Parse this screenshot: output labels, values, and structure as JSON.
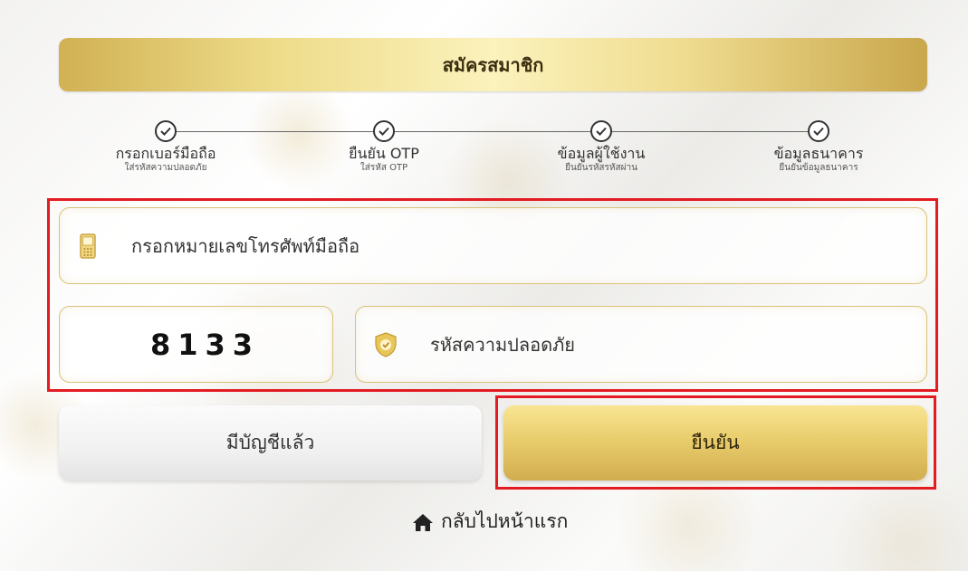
{
  "header": {
    "title": "สมัครสมาชิก"
  },
  "steps": [
    {
      "title": "กรอกเบอร์มือถือ",
      "subtitle": "ใส่รหัสความปลอดภัย",
      "icon": "check-icon"
    },
    {
      "title": "ยืนยัน OTP",
      "subtitle": "ใส่รหัส OTP",
      "icon": "check-icon"
    },
    {
      "title": "ข้อมูลผู้ใช้งาน",
      "subtitle": "ยืนยันรหัสรหัสผ่าน",
      "icon": "check-icon"
    },
    {
      "title": "ข้อมูลธนาคาร",
      "subtitle": "ยืนยันข้อมูลธนาคาร",
      "icon": "check-icon"
    }
  ],
  "form": {
    "phone": {
      "placeholder": "กรอกหมายเลขโทรศัพท์มือถือ",
      "value": "",
      "icon": "mobile-phone-icon"
    },
    "captcha": {
      "code": "8133"
    },
    "security_code": {
      "placeholder": "รหัสความปลอดภัย",
      "value": "",
      "icon": "shield-check-icon"
    }
  },
  "buttons": {
    "have_account": "มีบัญชีแล้ว",
    "confirm": "ยืนยัน"
  },
  "footer": {
    "home_label": "กลับไปหน้าแรก",
    "home_icon": "home-icon"
  },
  "colors": {
    "gold_accent": "#d9c27a",
    "highlight_red": "#e31b23"
  }
}
